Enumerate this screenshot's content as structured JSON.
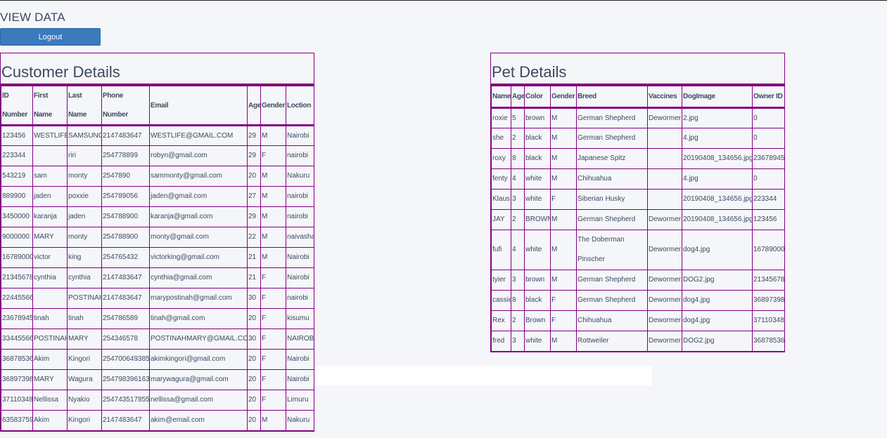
{
  "page": {
    "title": "VIEW DATA",
    "logout_label": "Logout"
  },
  "customers": {
    "title": "Customer Details",
    "columns": [
      "ID Number",
      "First Name",
      "Last Name",
      "Phone Number",
      "Email",
      "Age",
      "Gender",
      "Loction"
    ],
    "rows": [
      [
        "123456",
        "WESTLIFE",
        "SAMSUNG",
        "2147483647",
        "WESTLIFE@GMAIL.COM",
        "29",
        "M",
        "Nairobi"
      ],
      [
        "223344",
        "",
        "riri",
        "254778899",
        "robyn@gmail.com",
        "29",
        "F",
        "nairobi"
      ],
      [
        "543219",
        "sam",
        "monty",
        "2547890",
        "sammonty@gmail.com",
        "20",
        "M",
        "Nakuru"
      ],
      [
        "889900",
        "jaden",
        "poxxie",
        "254789056",
        "jaden@gmail.com",
        "27",
        "M",
        "nairobi"
      ],
      [
        "3450000",
        "karanja",
        "jaden",
        "254788900",
        "karanja@gmail.com",
        "29",
        "M",
        "nairobi"
      ],
      [
        "9000000",
        "MARY",
        "monty",
        "254788900",
        "monty@gmail.com",
        "22",
        "M",
        "naivasha"
      ],
      [
        "16789000",
        "victor",
        "king",
        "254765432",
        "victorking@gmail.com",
        "21",
        "M",
        "Nairobi"
      ],
      [
        "21345678",
        "cynthia",
        "cynthia",
        "2147483647",
        "cynthia@gmail.com",
        "21",
        "F",
        "Nairobi"
      ],
      [
        "22445566",
        "",
        "POSTINAH",
        "2147483647",
        "marypostinah@gmail.com",
        "30",
        "F",
        "nairobi"
      ],
      [
        "23678945",
        "tinah",
        "tinah",
        "254786589",
        "tinah@gmail.com",
        "20",
        "F",
        "kisumu"
      ],
      [
        "33445566",
        "POSTINAH",
        "MARY",
        "254346578",
        "POSTINAHMARY@GMAIL.COM",
        "30",
        "F",
        "NAIROBI"
      ],
      [
        "36878536",
        "Akim",
        "Kingori",
        "254700649385",
        "akimkingori@gmail.com",
        "20",
        "F",
        "Nairobi"
      ],
      [
        "36897398",
        "MARY",
        "Wagura",
        "254798396163",
        "marywagura@gmail.com",
        "20",
        "F",
        "Nairobi"
      ],
      [
        "37110348",
        "Nellissa",
        "Nyakio",
        "254743517855",
        "nellissa@gmail.com",
        "20",
        "F",
        "Limuru"
      ],
      [
        "63583759",
        "Akim",
        "Kingori",
        "2147483647",
        "akim@email.com",
        "20",
        "M",
        "Nakuru"
      ]
    ]
  },
  "pets": {
    "title": "Pet Details",
    "columns": [
      "Name",
      "Age",
      "Color",
      "Gender",
      "Breed",
      "Vaccines",
      "DogImage",
      "Owner ID"
    ],
    "rows": [
      [
        "roxie",
        "5",
        "brown",
        "M",
        "German Shepherd",
        "Dewormer",
        "2.jpg",
        "0"
      ],
      [
        "she",
        "2",
        "black",
        "M",
        "German Shepherd",
        "",
        "4.jpg",
        "0"
      ],
      [
        "roxy",
        "8",
        "black",
        "M",
        "Japanese Spitz",
        "",
        "20190408_134656.jpg",
        "23678945"
      ],
      [
        "fenty",
        "4",
        "white",
        "M",
        "Chihuahua",
        "",
        "4.jpg",
        "0"
      ],
      [
        "Klaus",
        "3",
        "white",
        "F",
        "Siberian Husky",
        "",
        "20190408_134656.jpg",
        "223344"
      ],
      [
        "JAY",
        "2",
        "BROWN",
        "M",
        "German Shepherd",
        "Dewormer",
        "20190408_134656.jpg",
        "123456"
      ],
      [
        "fufi",
        "4",
        "white",
        "M",
        "The Doberman Pinscher",
        "Dewormer",
        "dog4.jpg",
        "16789000"
      ],
      [
        "tyier",
        "3",
        "brown",
        "M",
        "German Shepherd",
        "Dewormer",
        "DOG2.jpg",
        "21345678"
      ],
      [
        "cassie",
        "8",
        "black",
        "F",
        "German Shepherd",
        "Dewormer",
        "dog4.jpg",
        "36897398"
      ],
      [
        "Rex",
        "2",
        "Brown",
        "F",
        "Chihuahua",
        "Dewormer",
        "dog4.jpg",
        "37110348"
      ],
      [
        "fred",
        "3",
        "white",
        "M",
        "Rottweiler",
        "Dewormer",
        "DOG2.jpg",
        "36878536"
      ]
    ]
  }
}
